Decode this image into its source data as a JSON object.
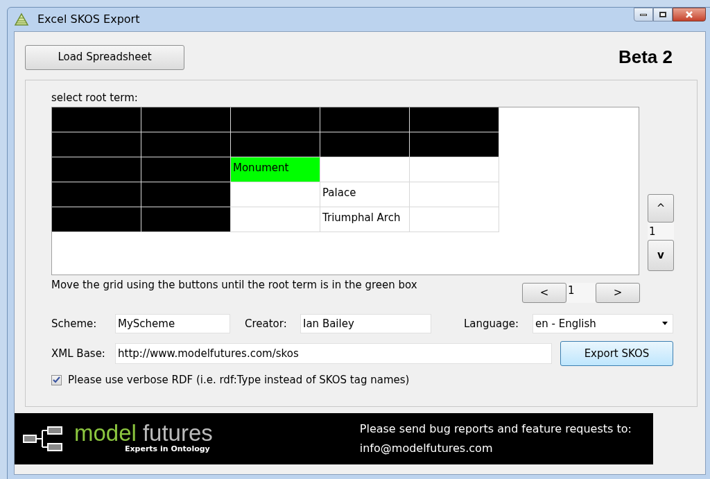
{
  "window": {
    "title": "Excel SKOS Export"
  },
  "load_button": "Load Spreadsheet",
  "version": "Beta 2",
  "grid": {
    "label": "select root term:",
    "rows": [
      [
        {
          "kind": "filled"
        },
        {
          "kind": "filled"
        },
        {
          "kind": "filled"
        },
        {
          "kind": "filled"
        },
        {
          "kind": "filled"
        }
      ],
      [
        {
          "kind": "filled"
        },
        {
          "kind": "filled"
        },
        {
          "kind": "filled"
        },
        {
          "kind": "filled"
        },
        {
          "kind": "filled"
        }
      ],
      [
        {
          "kind": "filled"
        },
        {
          "kind": "filled"
        },
        {
          "kind": "root",
          "text": "Monument"
        },
        {
          "kind": "empty"
        },
        {
          "kind": "empty"
        }
      ],
      [
        {
          "kind": "filled"
        },
        {
          "kind": "filled"
        },
        {
          "kind": "empty"
        },
        {
          "kind": "term",
          "text": "Palace"
        },
        {
          "kind": "empty"
        }
      ],
      [
        {
          "kind": "filled"
        },
        {
          "kind": "filled"
        },
        {
          "kind": "empty"
        },
        {
          "kind": "term",
          "text": "Triumphal Arch"
        },
        {
          "kind": "empty"
        }
      ]
    ],
    "hint": "Move the grid using the buttons until the root term is in the green box",
    "vertical": {
      "up": "^",
      "value": "1",
      "down": "v"
    },
    "horizontal": {
      "left": "<",
      "value": "1",
      "right": ">"
    }
  },
  "form": {
    "scheme_label": "Scheme:",
    "scheme": "MyScheme",
    "creator_label": "Creator:",
    "creator": "Ian Bailey",
    "language_label": "Language:",
    "language": "en - English",
    "xml_base_label": "XML Base:",
    "xml_base": "http://www.modelfutures.com/skos",
    "export_button": "Export SKOS",
    "verbose": {
      "label": "Please use verbose RDF (i.e. rdf:Type instead of SKOS tag names)",
      "checked": true
    }
  },
  "footer": {
    "brand_1": "model",
    "brand_2": "futures",
    "tagline": "Experts in Ontology",
    "message": "Please send bug reports and feature requests to:",
    "email": "info@modelfutures.com"
  }
}
